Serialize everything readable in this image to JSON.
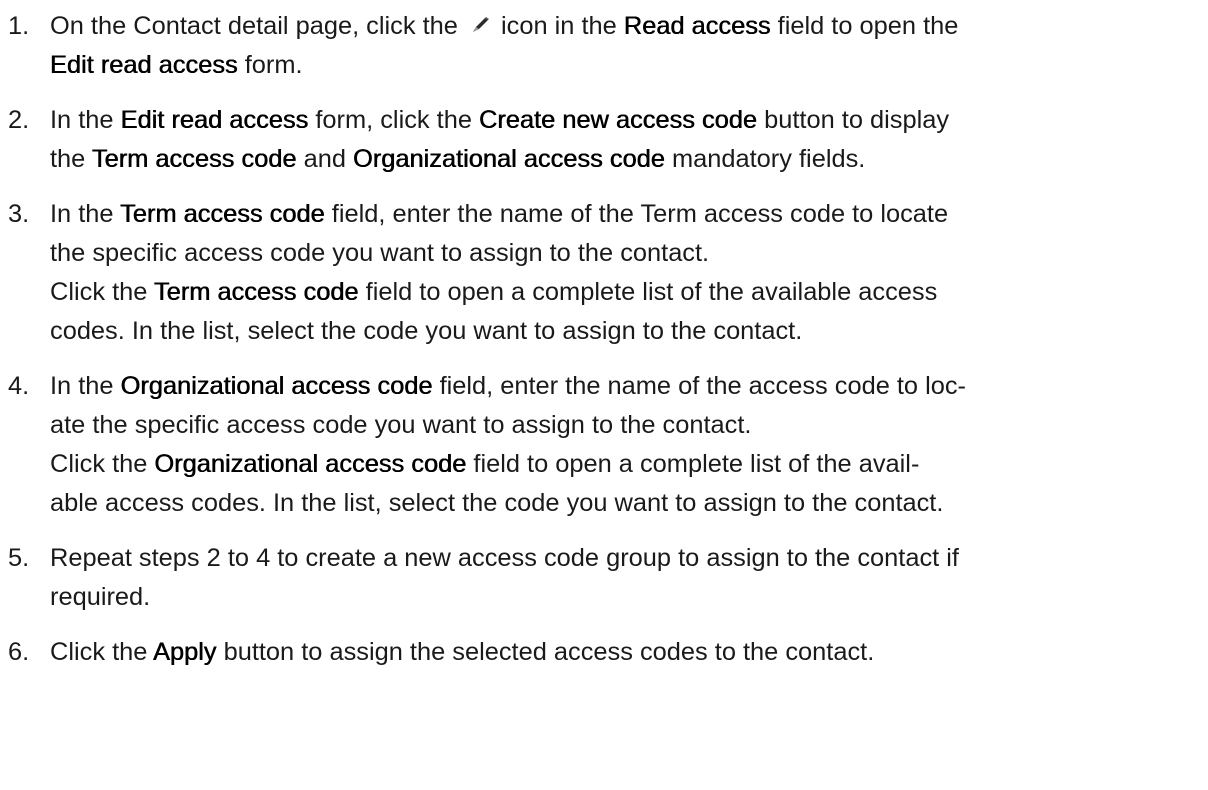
{
  "steps": [
    {
      "number": "1.",
      "lines": [
        {
          "t1": "On the Contact detail page, click the ",
          "icon": "pencil-icon",
          "t2": " icon in the ",
          "b1": "Read access",
          "t3": " field to open the"
        },
        {
          "b1": "Edit read access",
          "t1": " form."
        }
      ]
    },
    {
      "number": "2.",
      "lines": [
        {
          "t1": "In the ",
          "b1": "Edit read access",
          "t2": " form, click the ",
          "b2": "Create new access code",
          "t3": " button to display"
        },
        {
          "t1": "the ",
          "b1": "Term access code",
          "t2": " and ",
          "b2": "Organizational access code",
          "t3": " mandatory fields."
        }
      ]
    },
    {
      "number": "3.",
      "lines": [
        {
          "t1": "In the ",
          "b1": "Term access code",
          "t2": " field, enter the name of the Term access code to locate"
        },
        {
          "t1": "the specific access code you want to assign to the contact."
        },
        {
          "t1": "Click the ",
          "b1": "Term access code",
          "t2": " field to open a complete list of the available access"
        },
        {
          "t1": "codes. In the list, select the code you want to assign to the contact."
        }
      ]
    },
    {
      "number": "4.",
      "lines": [
        {
          "t1": "In the ",
          "b1": "Organizational access code",
          "t2": " field, enter the name of the access code to loc-"
        },
        {
          "t1": "ate the specific access code you want to assign to the contact."
        },
        {
          "t1": "Click the ",
          "b1": "Organizational access code",
          "t2": " field to open a complete list of the avail-"
        },
        {
          "t1": "able access codes. In the list, select the code you want to assign to the contact."
        }
      ]
    },
    {
      "number": "5.",
      "lines": [
        {
          "t1": "Repeat steps 2 to 4 to create a new access code group to assign to the contact if"
        },
        {
          "t1": "required."
        }
      ]
    },
    {
      "number": "6.",
      "lines": [
        {
          "t1": "Click the ",
          "b1": "Apply",
          "t2": " button to assign the selected access codes to the contact."
        }
      ]
    }
  ]
}
